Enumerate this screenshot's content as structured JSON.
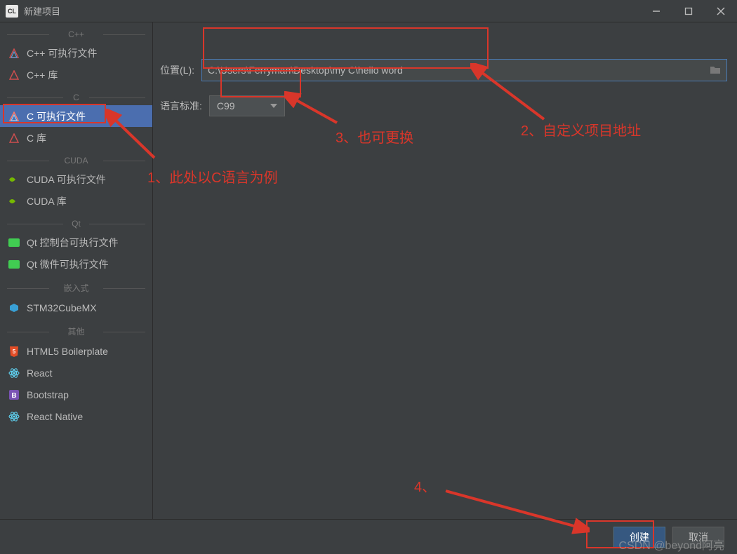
{
  "window": {
    "title": "新建项目"
  },
  "sidebar": {
    "categories": [
      {
        "label": "C++",
        "items": [
          {
            "icon": "triangle",
            "label": "C++ 可执行文件"
          },
          {
            "icon": "triangle",
            "label": "C++ 库"
          }
        ]
      },
      {
        "label": "C",
        "items": [
          {
            "icon": "triangle",
            "label": "C 可执行文件",
            "selected": true
          },
          {
            "icon": "triangle",
            "label": "C 库"
          }
        ]
      },
      {
        "label": "CUDA",
        "items": [
          {
            "icon": "nvidia",
            "label": "CUDA 可执行文件"
          },
          {
            "icon": "nvidia",
            "label": "CUDA 库"
          }
        ]
      },
      {
        "label": "Qt",
        "items": [
          {
            "icon": "qt",
            "label": "Qt 控制台可执行文件"
          },
          {
            "icon": "qt",
            "label": "Qt 微件可执行文件"
          }
        ]
      },
      {
        "label": "嵌入式",
        "items": [
          {
            "icon": "cube",
            "label": "STM32CubeMX"
          }
        ]
      },
      {
        "label": "其他",
        "items": [
          {
            "icon": "html5",
            "label": "HTML5 Boilerplate"
          },
          {
            "icon": "react",
            "label": "React"
          },
          {
            "icon": "bootstrap",
            "label": "Bootstrap"
          },
          {
            "icon": "react",
            "label": "React Native"
          }
        ]
      }
    ]
  },
  "form": {
    "location_label": "位置(L):",
    "location_value": "C:\\Users\\Ferryman\\Desktop\\my C\\hello word",
    "standard_label": "语言标准:",
    "standard_value": "C99"
  },
  "footer": {
    "create": "创建",
    "cancel": "取消"
  },
  "annotations": {
    "a1": "1、此处以C语言为例",
    "a2": "2、自定义项目地址",
    "a3": "3、也可更换",
    "a4": "4、"
  },
  "watermark": "CSDN @beyond阿亮"
}
